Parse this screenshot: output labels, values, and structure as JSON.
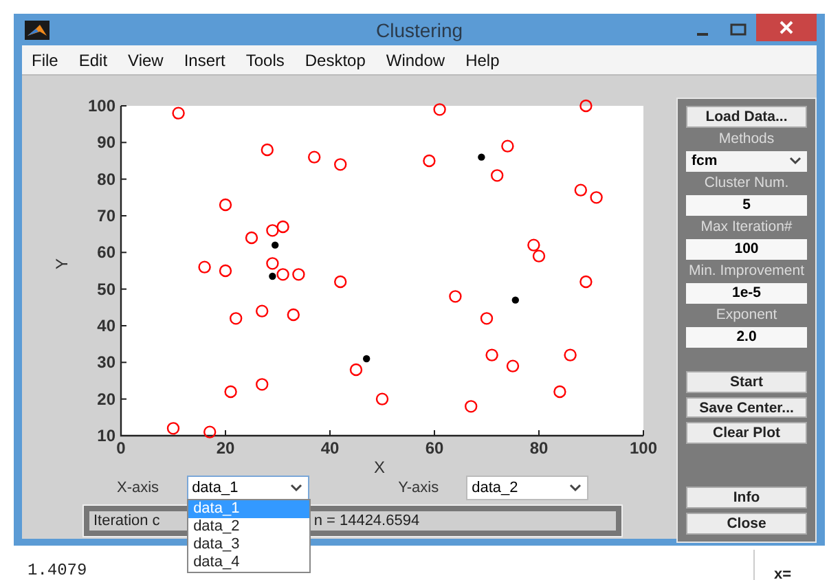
{
  "window": {
    "title": "Clustering"
  },
  "menu": [
    "File",
    "Edit",
    "View",
    "Insert",
    "Tools",
    "Desktop",
    "Window",
    "Help"
  ],
  "plot": {
    "chart_data": {
      "type": "scatter",
      "xlabel": "X",
      "ylabel": "Y",
      "xlim": [
        0,
        100
      ],
      "ylim": [
        10,
        100
      ],
      "xticks": [
        0,
        20,
        40,
        60,
        80,
        100
      ],
      "yticks": [
        10,
        20,
        30,
        40,
        50,
        60,
        70,
        80,
        90,
        100
      ],
      "series": [
        {
          "color": "#ff0000",
          "x": [
            11,
            61,
            89,
            28,
            37,
            42,
            59,
            74,
            72,
            88,
            91,
            20,
            31,
            29,
            25,
            79,
            80,
            16,
            20,
            29,
            31,
            34,
            42,
            89,
            64,
            27,
            33,
            22,
            70,
            71,
            86,
            75,
            45,
            21,
            27,
            84,
            50,
            67,
            10,
            17
          ],
          "values": [
            98,
            99,
            100,
            88,
            86,
            84,
            85,
            89,
            81,
            77,
            75,
            73,
            67,
            66,
            64,
            62,
            59,
            56,
            55,
            57,
            54,
            54,
            52,
            52,
            48,
            44,
            43,
            42,
            42,
            32,
            32,
            29,
            28,
            22,
            24,
            22,
            20,
            18,
            12,
            11
          ]
        },
        {
          "color": "#000000",
          "x": [
            69,
            29.5,
            29,
            75.5,
            47
          ],
          "values": [
            86,
            62,
            53.5,
            47,
            31
          ]
        }
      ]
    }
  },
  "axis_selectors": [
    {
      "label": "X-axis",
      "value": "data_1",
      "open": true,
      "options": [
        {
          "label": "data_1",
          "selected": true
        },
        {
          "label": "data_2",
          "selected": false
        },
        {
          "label": "data_3",
          "selected": false
        },
        {
          "label": "data_4",
          "selected": false
        }
      ]
    },
    {
      "label": "Y-axis",
      "value": "data_2",
      "open": false
    }
  ],
  "status": {
    "parts": [
      "Iteration c",
      "n = 14424.6594"
    ]
  },
  "panel": {
    "items": [
      {
        "kind": "button",
        "label": "Load Data..."
      },
      {
        "kind": "caption",
        "label": "Methods"
      },
      {
        "kind": "select",
        "value": "fcm"
      },
      {
        "kind": "caption",
        "label": "Cluster Num."
      },
      {
        "kind": "field",
        "value": "5"
      },
      {
        "kind": "caption",
        "label": "Max Iteration#"
      },
      {
        "kind": "field",
        "value": "100"
      },
      {
        "kind": "caption",
        "label": "Min. Improvement"
      },
      {
        "kind": "field",
        "value": "1e-5"
      },
      {
        "kind": "caption",
        "label": "Exponent"
      },
      {
        "kind": "field",
        "value": "2.0"
      },
      {
        "kind": "spacer"
      },
      {
        "kind": "button",
        "label": "Start"
      },
      {
        "kind": "button",
        "label": "Save Center..."
      },
      {
        "kind": "button",
        "label": "Clear Plot"
      },
      {
        "kind": "spacer"
      },
      {
        "kind": "spacer"
      },
      {
        "kind": "button",
        "label": "Info"
      },
      {
        "kind": "button",
        "label": "Close"
      }
    ]
  },
  "command_window": {
    "output": "1.4079",
    "side_text": "x="
  }
}
